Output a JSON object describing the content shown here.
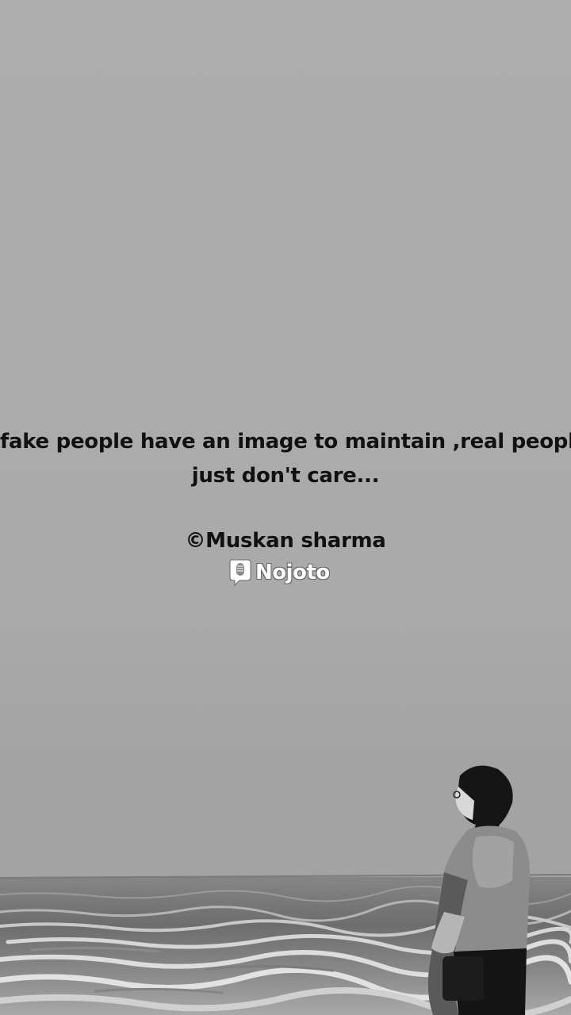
{
  "quote": {
    "line1": "fake people have an image to maintain ,real people",
    "line2": "just don't care..."
  },
  "credit": "©Muskan sharma",
  "logo": {
    "text": "Nojoto",
    "icon": "microphone-icon"
  },
  "colors": {
    "sky": "#acacac",
    "sea": "#6e6e6e",
    "text": "#111111",
    "logo_text": "#ffffff"
  }
}
